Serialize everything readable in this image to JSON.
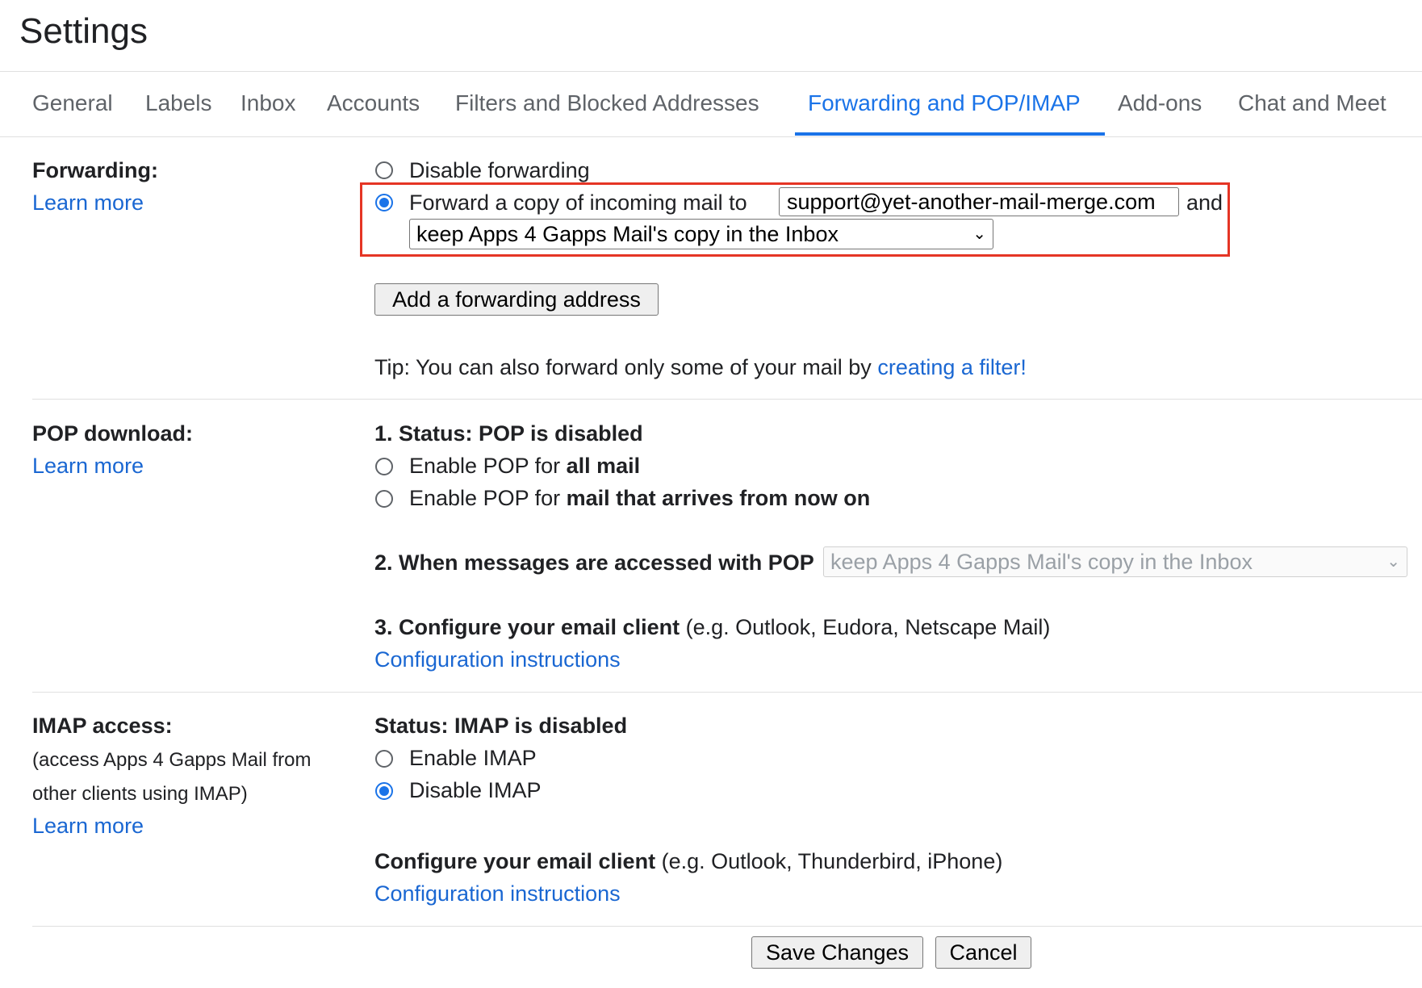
{
  "header": {
    "title": "Settings"
  },
  "tabs": [
    {
      "label": "General"
    },
    {
      "label": "Labels"
    },
    {
      "label": "Inbox"
    },
    {
      "label": "Accounts"
    },
    {
      "label": "Filters and Blocked Addresses"
    },
    {
      "label": "Forwarding and POP/IMAP",
      "active": true
    },
    {
      "label": "Add-ons"
    },
    {
      "label": "Chat and Meet"
    }
  ],
  "forwarding": {
    "label": "Forwarding:",
    "learn_more": "Learn more",
    "disable_label": "Disable forwarding",
    "forward_label": "Forward a copy of incoming mail to",
    "forward_address": "support@yet-another-mail-merge.com",
    "and_text": "and",
    "action_selected": "keep Apps 4 Gapps Mail's copy in the Inbox",
    "selected_option": "forward",
    "add_button": "Add a forwarding address",
    "tip_text": "Tip: You can also forward only some of your mail by",
    "tip_link": "creating a filter!"
  },
  "pop": {
    "label": "POP download:",
    "learn_more": "Learn more",
    "status": "1. Status: POP is disabled",
    "enable_all_prefix": "Enable POP for",
    "enable_all_bold": "all mail",
    "enable_now_prefix": "Enable POP for",
    "enable_now_bold": "mail that arrives from now on",
    "accessed_label": "2. When messages are accessed with POP",
    "accessed_selected": "keep Apps 4 Gapps Mail's copy in the Inbox",
    "configure_bold": "3. Configure your email client",
    "configure_rest": "(e.g. Outlook, Eudora, Netscape Mail)",
    "configure_link": "Configuration instructions"
  },
  "imap": {
    "label": "IMAP access:",
    "sub_line1": "(access Apps 4 Gapps Mail from",
    "sub_line2": "other clients using IMAP)",
    "learn_more": "Learn more",
    "status": "Status: IMAP is disabled",
    "enable_label": "Enable IMAP",
    "disable_label": "Disable IMAP",
    "selected_option": "disable",
    "configure_bold": "Configure your email client",
    "configure_rest": "(e.g. Outlook, Thunderbird, iPhone)",
    "configure_link": "Configuration instructions"
  },
  "footer": {
    "save_label": "Save Changes",
    "cancel_label": "Cancel"
  },
  "colors": {
    "accent": "#1a73e8",
    "link": "#1a67d2",
    "highlight_border": "#e53525"
  }
}
